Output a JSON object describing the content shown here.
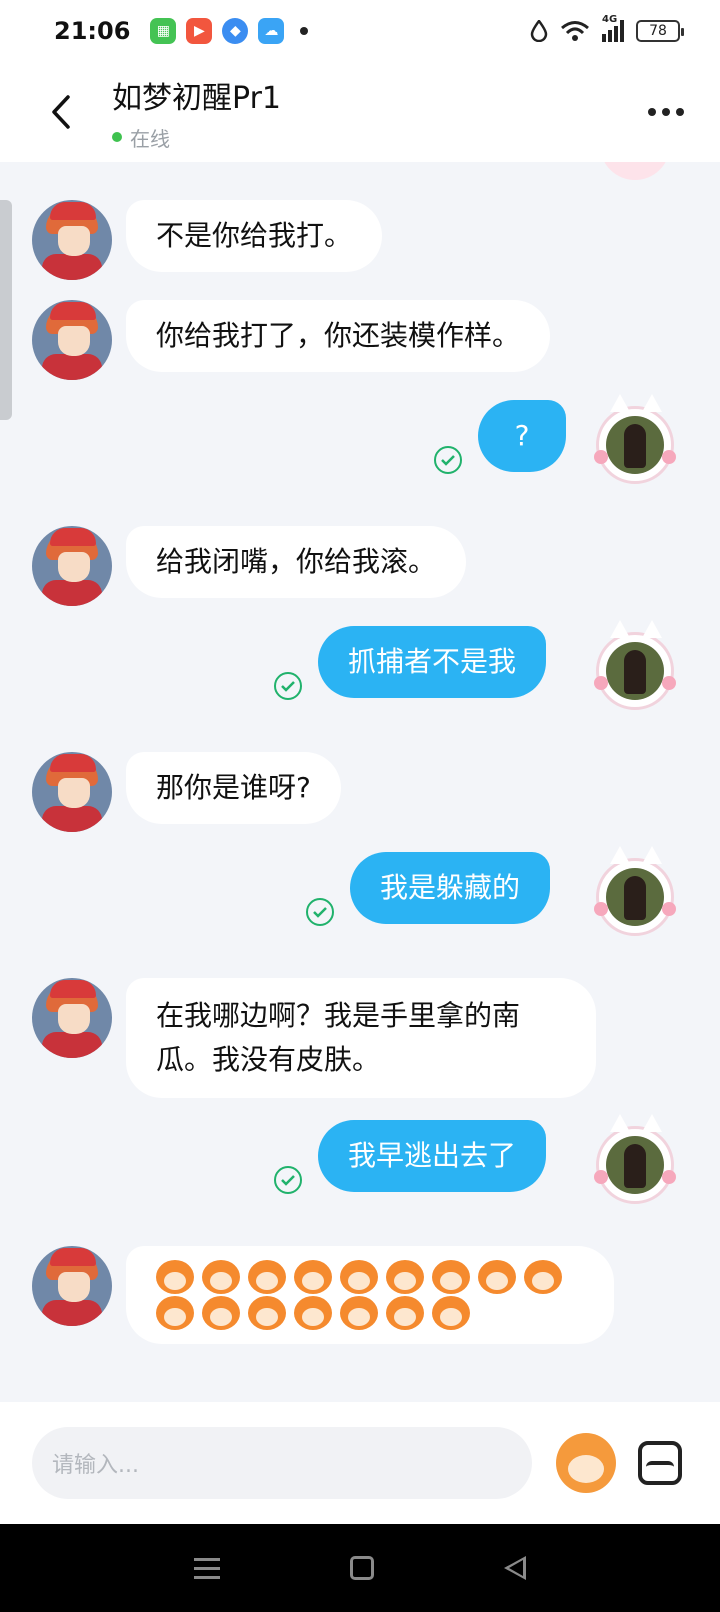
{
  "status_bar": {
    "time": "21:06",
    "network": "4G",
    "battery": "78"
  },
  "header": {
    "contact_name": "如梦初醒Pr1",
    "status": "在线"
  },
  "messages": [
    {
      "side": "left",
      "text": "不是你给我打。"
    },
    {
      "side": "left",
      "text": "你给我打了，你还装模作样。"
    },
    {
      "side": "right",
      "text": "?"
    },
    {
      "side": "left",
      "text": "给我闭嘴，你给我滚。"
    },
    {
      "side": "right",
      "text": "抓捕者不是我"
    },
    {
      "side": "left",
      "text": "那你是谁呀?"
    },
    {
      "side": "right",
      "text": "我是躲藏的"
    },
    {
      "side": "left",
      "text": "在我哪边啊？我是手里拿的南瓜。我没有皮肤。"
    },
    {
      "side": "right",
      "text": "我早逃出去了"
    },
    {
      "side": "left",
      "type": "emoji-set",
      "count": 16
    }
  ],
  "input": {
    "placeholder": "请输入..."
  },
  "colors": {
    "bubble_right": "#2bb3f3",
    "bubble_left": "#ffffff",
    "read_check": "#20b26c",
    "online": "#3fc24f"
  }
}
